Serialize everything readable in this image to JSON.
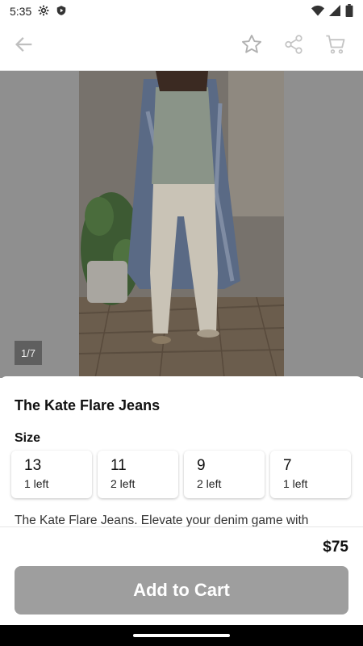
{
  "status_bar": {
    "time": "5:35"
  },
  "app_bar": {
    "back_icon": "arrow-left-icon",
    "favorite_icon": "star-icon",
    "share_icon": "share-icon",
    "cart_icon": "cart-icon"
  },
  "gallery": {
    "counter": "1/7"
  },
  "product": {
    "title": "The Kate Flare Jeans",
    "size_label": "Size",
    "sizes": [
      {
        "value": "13",
        "stock": "1 left"
      },
      {
        "value": "11",
        "stock": "2 left"
      },
      {
        "value": "9",
        "stock": "2 left"
      },
      {
        "value": "7",
        "stock": "1 left"
      }
    ],
    "description": "The Kate Flare Jeans. Elevate your denim game with",
    "price": "$75",
    "add_to_cart": "Add to Cart"
  },
  "colors": {
    "button_disabled": "#9e9e9e",
    "overlay": "#8f8f8f"
  }
}
